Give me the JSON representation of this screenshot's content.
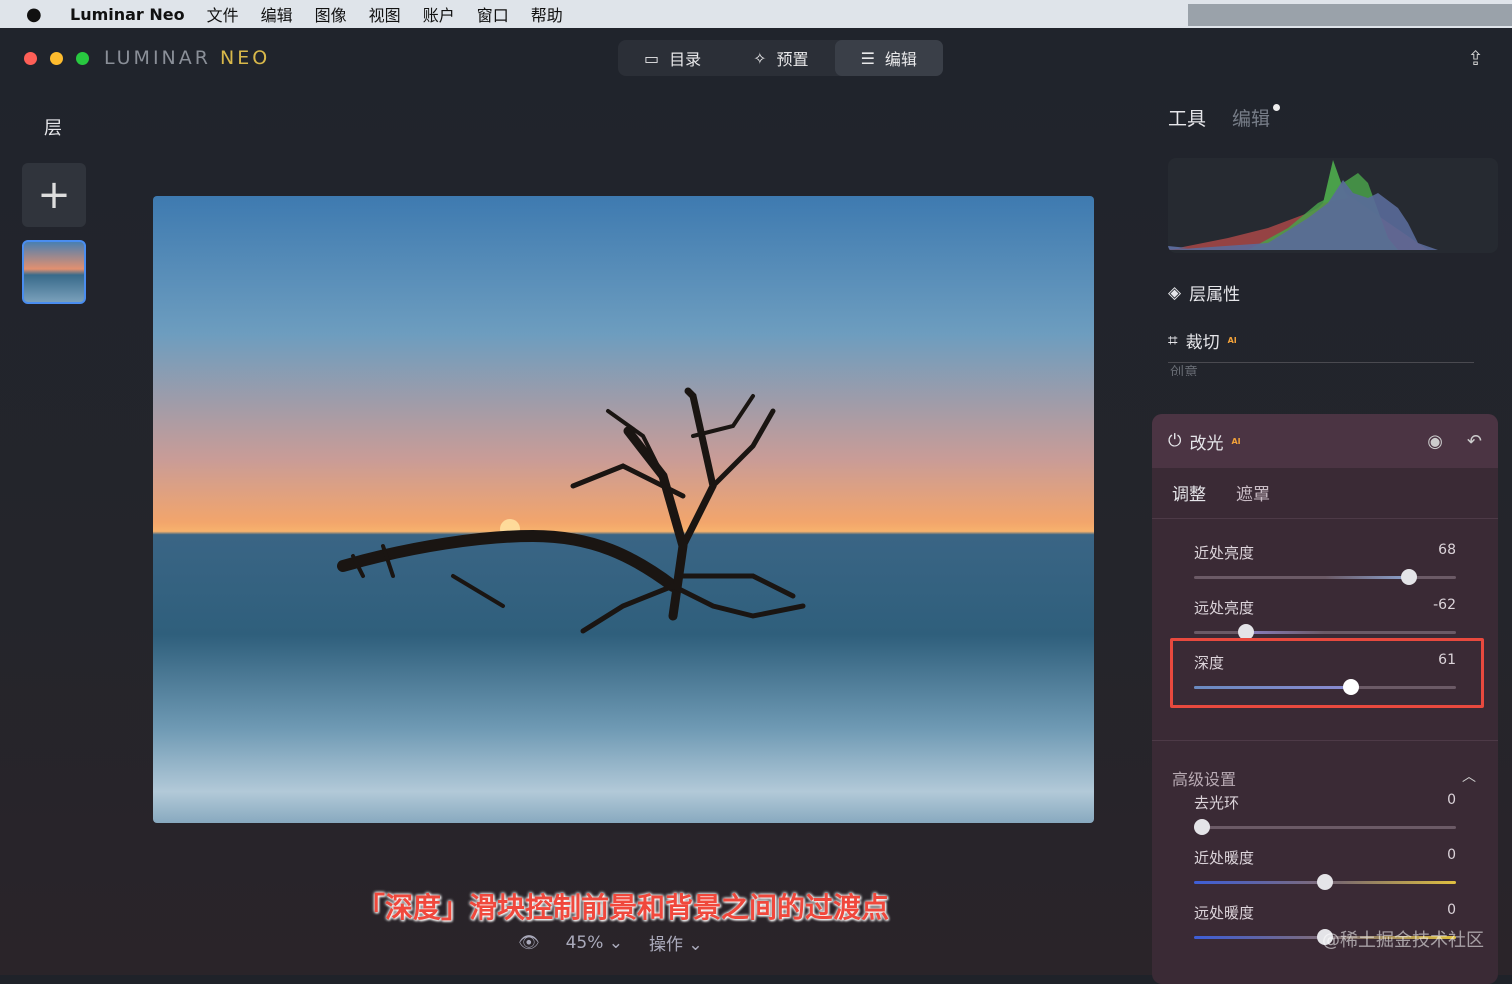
{
  "menubar": {
    "app": "Luminar Neo",
    "items": [
      "文件",
      "编辑",
      "图像",
      "视图",
      "账户",
      "窗口",
      "帮助"
    ]
  },
  "window": {
    "logo_a": "LUMINAR",
    "logo_b": "NEO",
    "traffic_colors": [
      "#fe5f57",
      "#febc2e",
      "#28c840"
    ]
  },
  "modes": [
    {
      "label": "目录",
      "icon": "folder-icon"
    },
    {
      "label": "预置",
      "icon": "sparkle-icon"
    },
    {
      "label": "编辑",
      "icon": "sliders-icon"
    }
  ],
  "layers": {
    "title": "层",
    "add": "+"
  },
  "caption": "「深度」滑块控制前景和背景之间的过渡点",
  "bottom": {
    "zoom": "45% ⌄",
    "actions": "操作 ⌄"
  },
  "right": {
    "tab_tools": "工具",
    "tab_edits": "编辑",
    "layer_props": "层属性",
    "crop": "裁切",
    "ai": "AI",
    "creative": "创意"
  },
  "panel": {
    "title": "改光",
    "ai": "AI",
    "tab_adjust": "调整",
    "tab_mask": "遮罩",
    "advanced": "高级设置",
    "sliders": [
      {
        "label": "近处亮度",
        "value": "68",
        "pos": 0.82
      },
      {
        "label": "远处亮度",
        "value": "-62",
        "pos": 0.2
      },
      {
        "label": "深度",
        "value": "61",
        "pos": 0.6
      }
    ],
    "adv_sliders": [
      {
        "label": "去光环",
        "value": "0",
        "pos": 0.03
      },
      {
        "label": "近处暖度",
        "value": "0",
        "pos": 0.5
      },
      {
        "label": "远处暖度",
        "value": "0",
        "pos": 0.5
      }
    ]
  },
  "watermark": "@稀土掘金技术社区"
}
